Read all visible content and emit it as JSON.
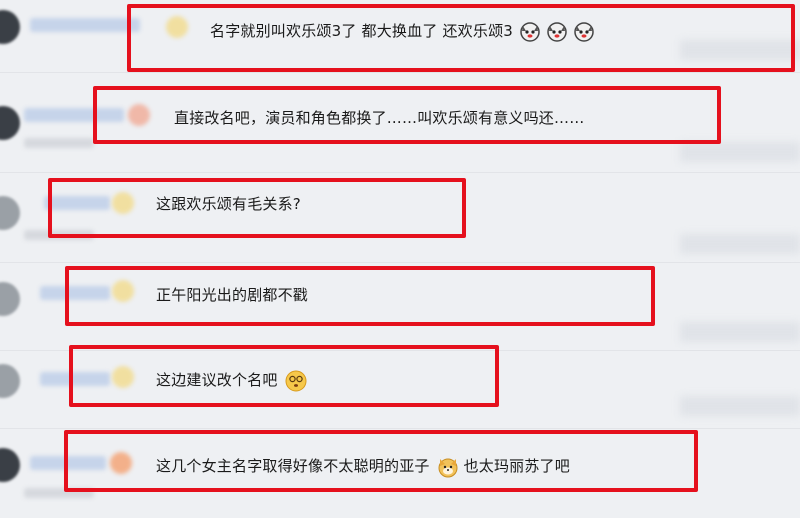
{
  "comments": [
    {
      "text": "名字就别叫欢乐颂3了 都大换血了 还欢乐颂3",
      "emojis": [
        "dog-face-icon",
        "dog-face-icon",
        "dog-face-icon"
      ]
    },
    {
      "text": "直接改名吧，演员和角色都换了……叫欢乐颂有意义吗还……"
    },
    {
      "text": "这跟欢乐颂有毛关系?"
    },
    {
      "text": "正午阳光出的剧都不戳"
    },
    {
      "text": "这边建议改个名吧",
      "emojis": [
        "dizzy-face-icon"
      ]
    },
    {
      "text": "这几个女主名字取得好像不太聪明的亚子",
      "emojis": [
        "shiba-face-icon"
      ],
      "text_after": "也太玛丽苏了吧"
    }
  ],
  "colors": {
    "highlight_border": "#e5101d",
    "background": "#eef0f3"
  }
}
